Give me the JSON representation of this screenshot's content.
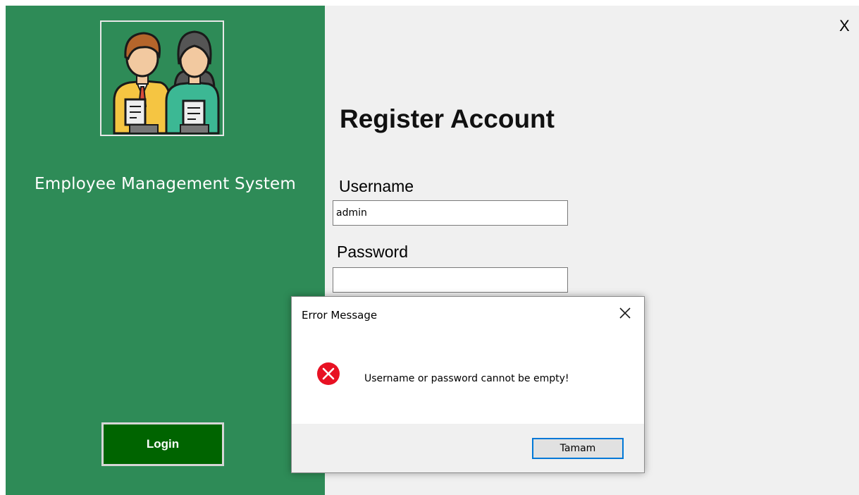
{
  "sidebar": {
    "app_name": "Employee Management System",
    "login_label": "Login",
    "logo_icon": "employees-icon"
  },
  "window": {
    "close_label": "X"
  },
  "form": {
    "title": "Register Account",
    "username_label": "Username",
    "username_value": "admin",
    "password_label": "Password",
    "password_value": ""
  },
  "dialog": {
    "title": "Error Message",
    "message": "Username or password cannot be empty!",
    "ok_label": "Tamam",
    "icon": "error-icon"
  },
  "colors": {
    "sidebar": "#2e8b57",
    "login_button": "#006400",
    "error_icon": "#e81123",
    "dialog_focus": "#0078d7"
  }
}
